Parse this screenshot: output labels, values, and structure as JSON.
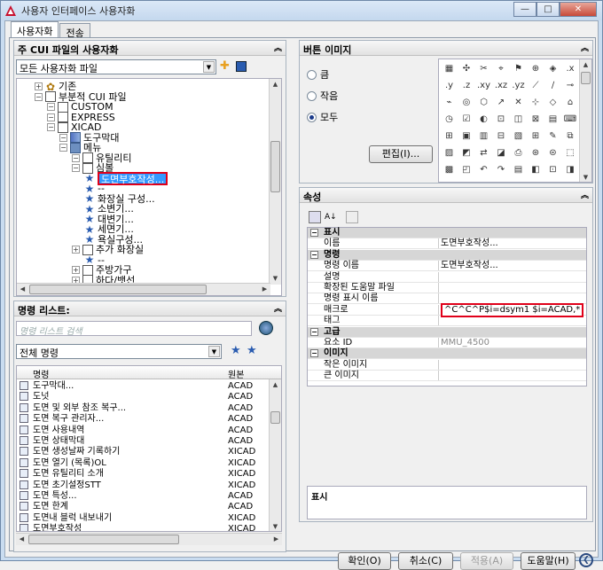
{
  "window": {
    "title": "사용자 인터페이스 사용자화"
  },
  "tabs": [
    {
      "label": "사용자화"
    },
    {
      "label": "전송"
    }
  ],
  "cui_panel": {
    "title": "주 CUI 파일의 사용자화",
    "file_combo": "모든 사용자화 파일",
    "tree": [
      {
        "label": "기존",
        "indent": 1,
        "icon": "gear-icon"
      },
      {
        "label": "부분적 CUI 파일",
        "indent": 1,
        "icon": "doc-icon"
      },
      {
        "label": "CUSTOM",
        "indent": 2,
        "icon": "doc-icon"
      },
      {
        "label": "EXPRESS",
        "indent": 2,
        "icon": "doc-icon"
      },
      {
        "label": "XICAD",
        "indent": 2,
        "icon": "doc-icon"
      },
      {
        "label": "도구막대",
        "indent": 3,
        "icon": "toolbar-icon"
      },
      {
        "label": "메뉴",
        "indent": 3,
        "icon": "menu-icon"
      },
      {
        "label": "유틸리티",
        "indent": 4,
        "icon": "doc-icon"
      },
      {
        "label": "심볼",
        "indent": 4,
        "icon": "doc-icon"
      },
      {
        "label": "도면부호작성...",
        "indent": 5,
        "icon": "star-icon",
        "selected": true
      },
      {
        "label": "--",
        "indent": 5,
        "icon": "star-icon"
      },
      {
        "label": "화장실 구성...",
        "indent": 5,
        "icon": "star-icon"
      },
      {
        "label": "소변기...",
        "indent": 5,
        "icon": "star-icon"
      },
      {
        "label": "대변기...",
        "indent": 5,
        "icon": "star-icon"
      },
      {
        "label": "세면기...",
        "indent": 5,
        "icon": "star-icon"
      },
      {
        "label": "욕실구성...",
        "indent": 5,
        "icon": "star-icon"
      },
      {
        "label": "추가 화장실",
        "indent": 4,
        "icon": "doc-icon"
      },
      {
        "label": "--",
        "indent": 5,
        "icon": "star-icon"
      },
      {
        "label": "주방가구",
        "indent": 4,
        "icon": "doc-icon"
      },
      {
        "label": "하다/뱃선",
        "indent": 4,
        "icon": "doc-icon"
      }
    ]
  },
  "command_panel": {
    "title": "명령 리스트:",
    "search_placeholder": "명령 리스트 검색",
    "filter_combo": "전체 명령",
    "col_command": "명령",
    "col_source": "원본",
    "rows": [
      {
        "name": "도구막대...",
        "source": "ACAD"
      },
      {
        "name": "도넛",
        "source": "ACAD"
      },
      {
        "name": "도면 및 외부 참조 복구...",
        "source": "ACAD"
      },
      {
        "name": "도면 복구 관리자...",
        "source": "ACAD"
      },
      {
        "name": "도면 사용내역",
        "source": "ACAD"
      },
      {
        "name": "도면 상태막대",
        "source": "ACAD"
      },
      {
        "name": "도면 생성날짜 기록하기",
        "source": "XICAD"
      },
      {
        "name": "도면 열기 (목록)OL",
        "source": "XICAD"
      },
      {
        "name": "도면 유틸리티 소개",
        "source": "XICAD"
      },
      {
        "name": "도면 초기설정STT",
        "source": "XICAD"
      },
      {
        "name": "도면 특성...",
        "source": "ACAD"
      },
      {
        "name": "도면 한계",
        "source": "ACAD"
      },
      {
        "name": "도면내 블럭 내보내기",
        "source": "XICAD"
      },
      {
        "name": "도면부호작성",
        "source": "XICAD"
      }
    ]
  },
  "button_image_panel": {
    "title": "버튼 이미지",
    "radio_small": "큼",
    "radio_medium": "작음",
    "radio_all": "모두",
    "edit_button": "편집(I)..."
  },
  "properties_panel": {
    "title": "속성",
    "rows": [
      {
        "type": "cat",
        "key": "표시"
      },
      {
        "type": "prop",
        "key": "이름",
        "value": "도면부호작성..."
      },
      {
        "type": "cat",
        "key": "명령"
      },
      {
        "type": "prop",
        "key": "명령 이름",
        "value": "도면부호작성..."
      },
      {
        "type": "prop",
        "key": "설명",
        "value": ""
      },
      {
        "type": "prop",
        "key": "확장된 도움말 파일",
        "value": ""
      },
      {
        "type": "prop",
        "key": "명령 표시 이름",
        "value": ""
      },
      {
        "type": "prop",
        "key": "매크로",
        "value": "^C^C^P$i=dsym1 $i=ACAD,*",
        "highlight": true
      },
      {
        "type": "prop",
        "key": "태그",
        "value": ""
      },
      {
        "type": "cat",
        "key": "고급"
      },
      {
        "type": "prop",
        "key": "요소 ID",
        "value": "MMU_4500",
        "gray": true
      },
      {
        "type": "cat",
        "key": "이미지"
      },
      {
        "type": "prop",
        "key": "작은 이미지",
        "value": ""
      },
      {
        "type": "prop",
        "key": "큰 이미지",
        "value": ""
      }
    ],
    "description_title": "표시"
  },
  "footer": {
    "ok": "확인(O)",
    "cancel": "취소(C)",
    "apply": "적용(A)",
    "help": "도움말(H)"
  }
}
